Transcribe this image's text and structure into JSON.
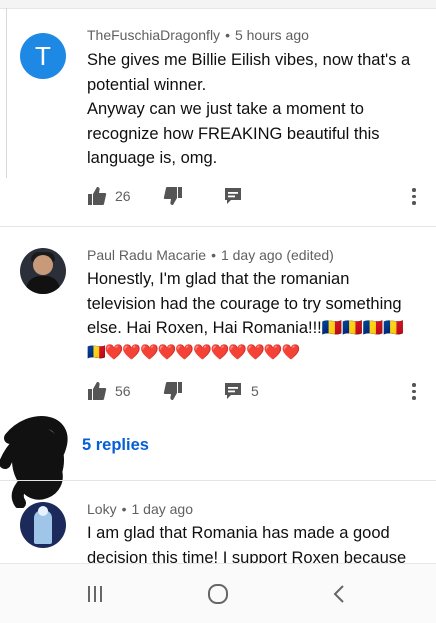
{
  "comments": [
    {
      "author": "TheFuschiaDragonfly",
      "time": "5 hours ago",
      "avatar_letter": "T",
      "lines": [
        "She gives me Billie Eilish vibes, now that's a potential winner.",
        "Anyway can we just take a moment to recognize how FREAKING beautiful this language is, omg."
      ],
      "likes": "26",
      "replies_count": ""
    },
    {
      "author": "Paul Radu Macarie",
      "time": "1 day ago (edited)",
      "lines": [
        "Honestly, I'm glad that the romanian television had the courage to try something else. Hai Roxen, Hai Romania!!!🇷🇴🇷🇴🇷🇴🇷🇴"
      ],
      "emoji_line": "🇷🇴❤️❤️❤️❤️❤️❤️❤️❤️❤️❤️❤️",
      "likes": "56",
      "replies_count": "5",
      "replies_link": "5 replies"
    },
    {
      "author": "Loky",
      "time": "1 day ago",
      "lines": [
        "I am glad that Romania has made a good decision this time! I support Roxen because"
      ]
    }
  ],
  "icons": {
    "like": "thumbs-up-icon",
    "dislike": "thumbs-down-icon",
    "reply": "reply-comment-icon",
    "more": "more-vert-icon",
    "nav": [
      "recent-apps-icon",
      "home-icon",
      "back-icon"
    ]
  },
  "colors": {
    "link": "#065fd4",
    "avatar_t": "#1e88e5",
    "heart": "#e0245e"
  }
}
